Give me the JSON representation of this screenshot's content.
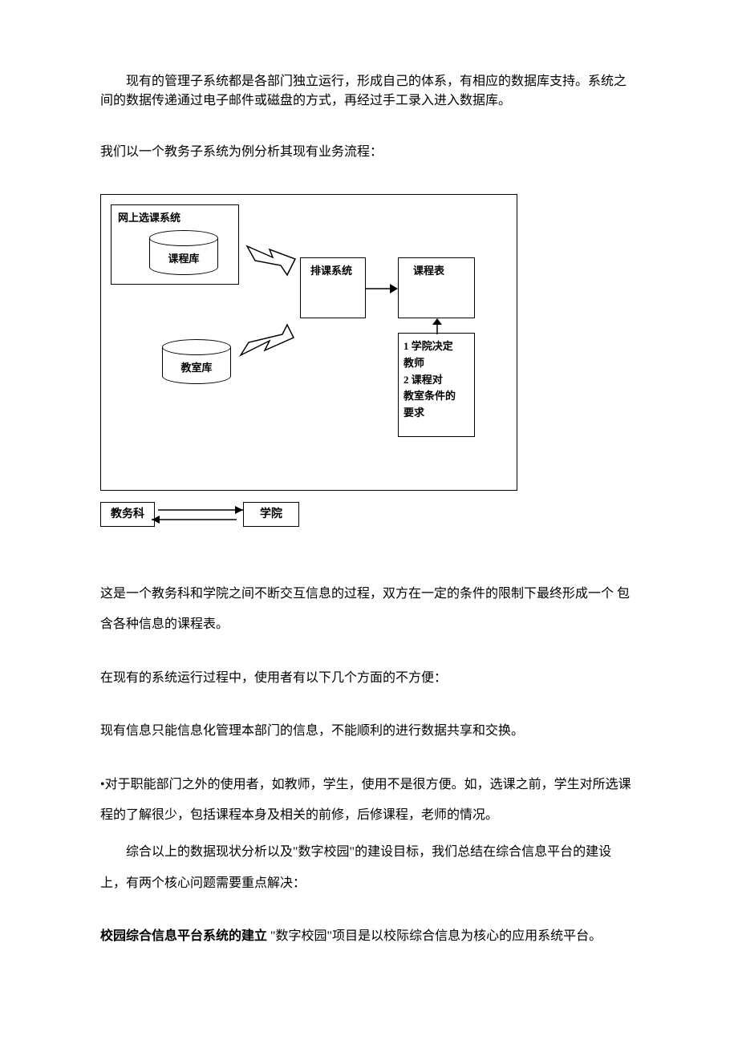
{
  "p1": "现有的管理子系统都是各部门独立运行，形成自己的体系，有相应的数据库支持。系统之间的数据传递通过电子邮件或磁盘的方式，再经过手工录入进入数据库。",
  "p2": "我们以一个教务子系统为例分析其现有业务流程：",
  "diagram": {
    "online_select": "网上选课系统",
    "db_course": "课程库",
    "db_room": "教室库",
    "schedule_sys": "排课系统",
    "timetable": "课程表",
    "factors_l1": "1  学院决定",
    "factors_l2": "教师",
    "factors_l3": "2    课程对",
    "factors_l4": "教室条件的",
    "factors_l5": "要求"
  },
  "interact": {
    "left": "教务科",
    "right": "学院"
  },
  "p3": "这是一个教务科和学院之间不断交互信息的过程，双方在一定的条件的限制下最终形成一个 包含各种信息的课程表。",
  "p4": "在现有的系统运行过程中，使用者有以下几个方面的不方便：",
  "p5": "现有信息只能信息化管理本部门的信息，不能顺利的进行数据共享和交换。",
  "p6": "•对于职能部门之外的使用者，如教师，学生，使用不是很方便。如，选课之前，学生对所选课程的了解很少，包括课程本身及相关的前修，后修课程，老师的情况。",
  "p7": "综合以上的数据现状分析以及\"数字校园\"的建设目标，我们总结在综合信息平台的建设 上，有两个核心问题需要重点解决：",
  "p8a": "校园综合信息平台系统的建立",
  "p8b": " \"数字校园\"项目是以校际综合信息为核心的应用系统平台。"
}
